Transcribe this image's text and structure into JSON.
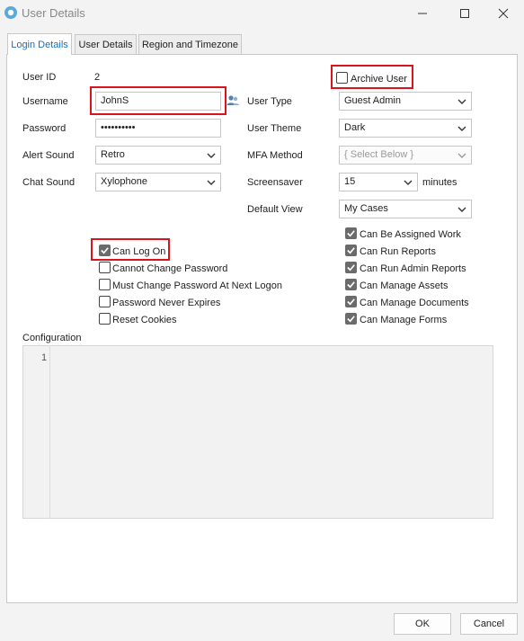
{
  "window": {
    "title": "User Details"
  },
  "tabs": [
    {
      "label": "Login Details",
      "active": true
    },
    {
      "label": "User Details",
      "active": false
    },
    {
      "label": "Region and Timezone",
      "active": false
    }
  ],
  "form": {
    "user_id": {
      "label": "User ID",
      "value": "2"
    },
    "username": {
      "label": "Username",
      "value": "JohnS"
    },
    "password": {
      "label": "Password",
      "value": "••••••••••"
    },
    "alert_sound": {
      "label": "Alert Sound",
      "value": "Retro"
    },
    "chat_sound": {
      "label": "Chat Sound",
      "value": "Xylophone"
    },
    "user_type": {
      "label": "User Type",
      "value": "Guest Admin"
    },
    "user_theme": {
      "label": "User Theme",
      "value": "Dark"
    },
    "mfa_method": {
      "label": "MFA Method",
      "value": "{ Select Below }"
    },
    "screensaver": {
      "label": "Screensaver",
      "value": "15",
      "unit": "minutes"
    },
    "default_view": {
      "label": "Default View",
      "value": "My Cases"
    },
    "archive_user": {
      "label": "Archive User",
      "checked": false
    }
  },
  "left_checks": [
    {
      "label": "Can Log On",
      "checked": true
    },
    {
      "label": "Cannot Change Password",
      "checked": false
    },
    {
      "label": "Must Change Password At Next Logon",
      "checked": false
    },
    {
      "label": "Password Never Expires",
      "checked": false
    },
    {
      "label": "Reset Cookies",
      "checked": false
    }
  ],
  "right_checks": [
    {
      "label": "Can Be Assigned Work",
      "checked": true
    },
    {
      "label": "Can Run Reports",
      "checked": true
    },
    {
      "label": "Can Run Admin Reports",
      "checked": true
    },
    {
      "label": "Can Manage Assets",
      "checked": true
    },
    {
      "label": "Can Manage Documents",
      "checked": true
    },
    {
      "label": "Can Manage Forms",
      "checked": true
    }
  ],
  "configuration": {
    "label": "Configuration",
    "line_number": "1"
  },
  "buttons": {
    "ok": "OK",
    "cancel": "Cancel"
  },
  "colors": {
    "accent": "#1a6fb8",
    "highlight": "#d9141c",
    "check_fill": "#6b6b6b"
  }
}
